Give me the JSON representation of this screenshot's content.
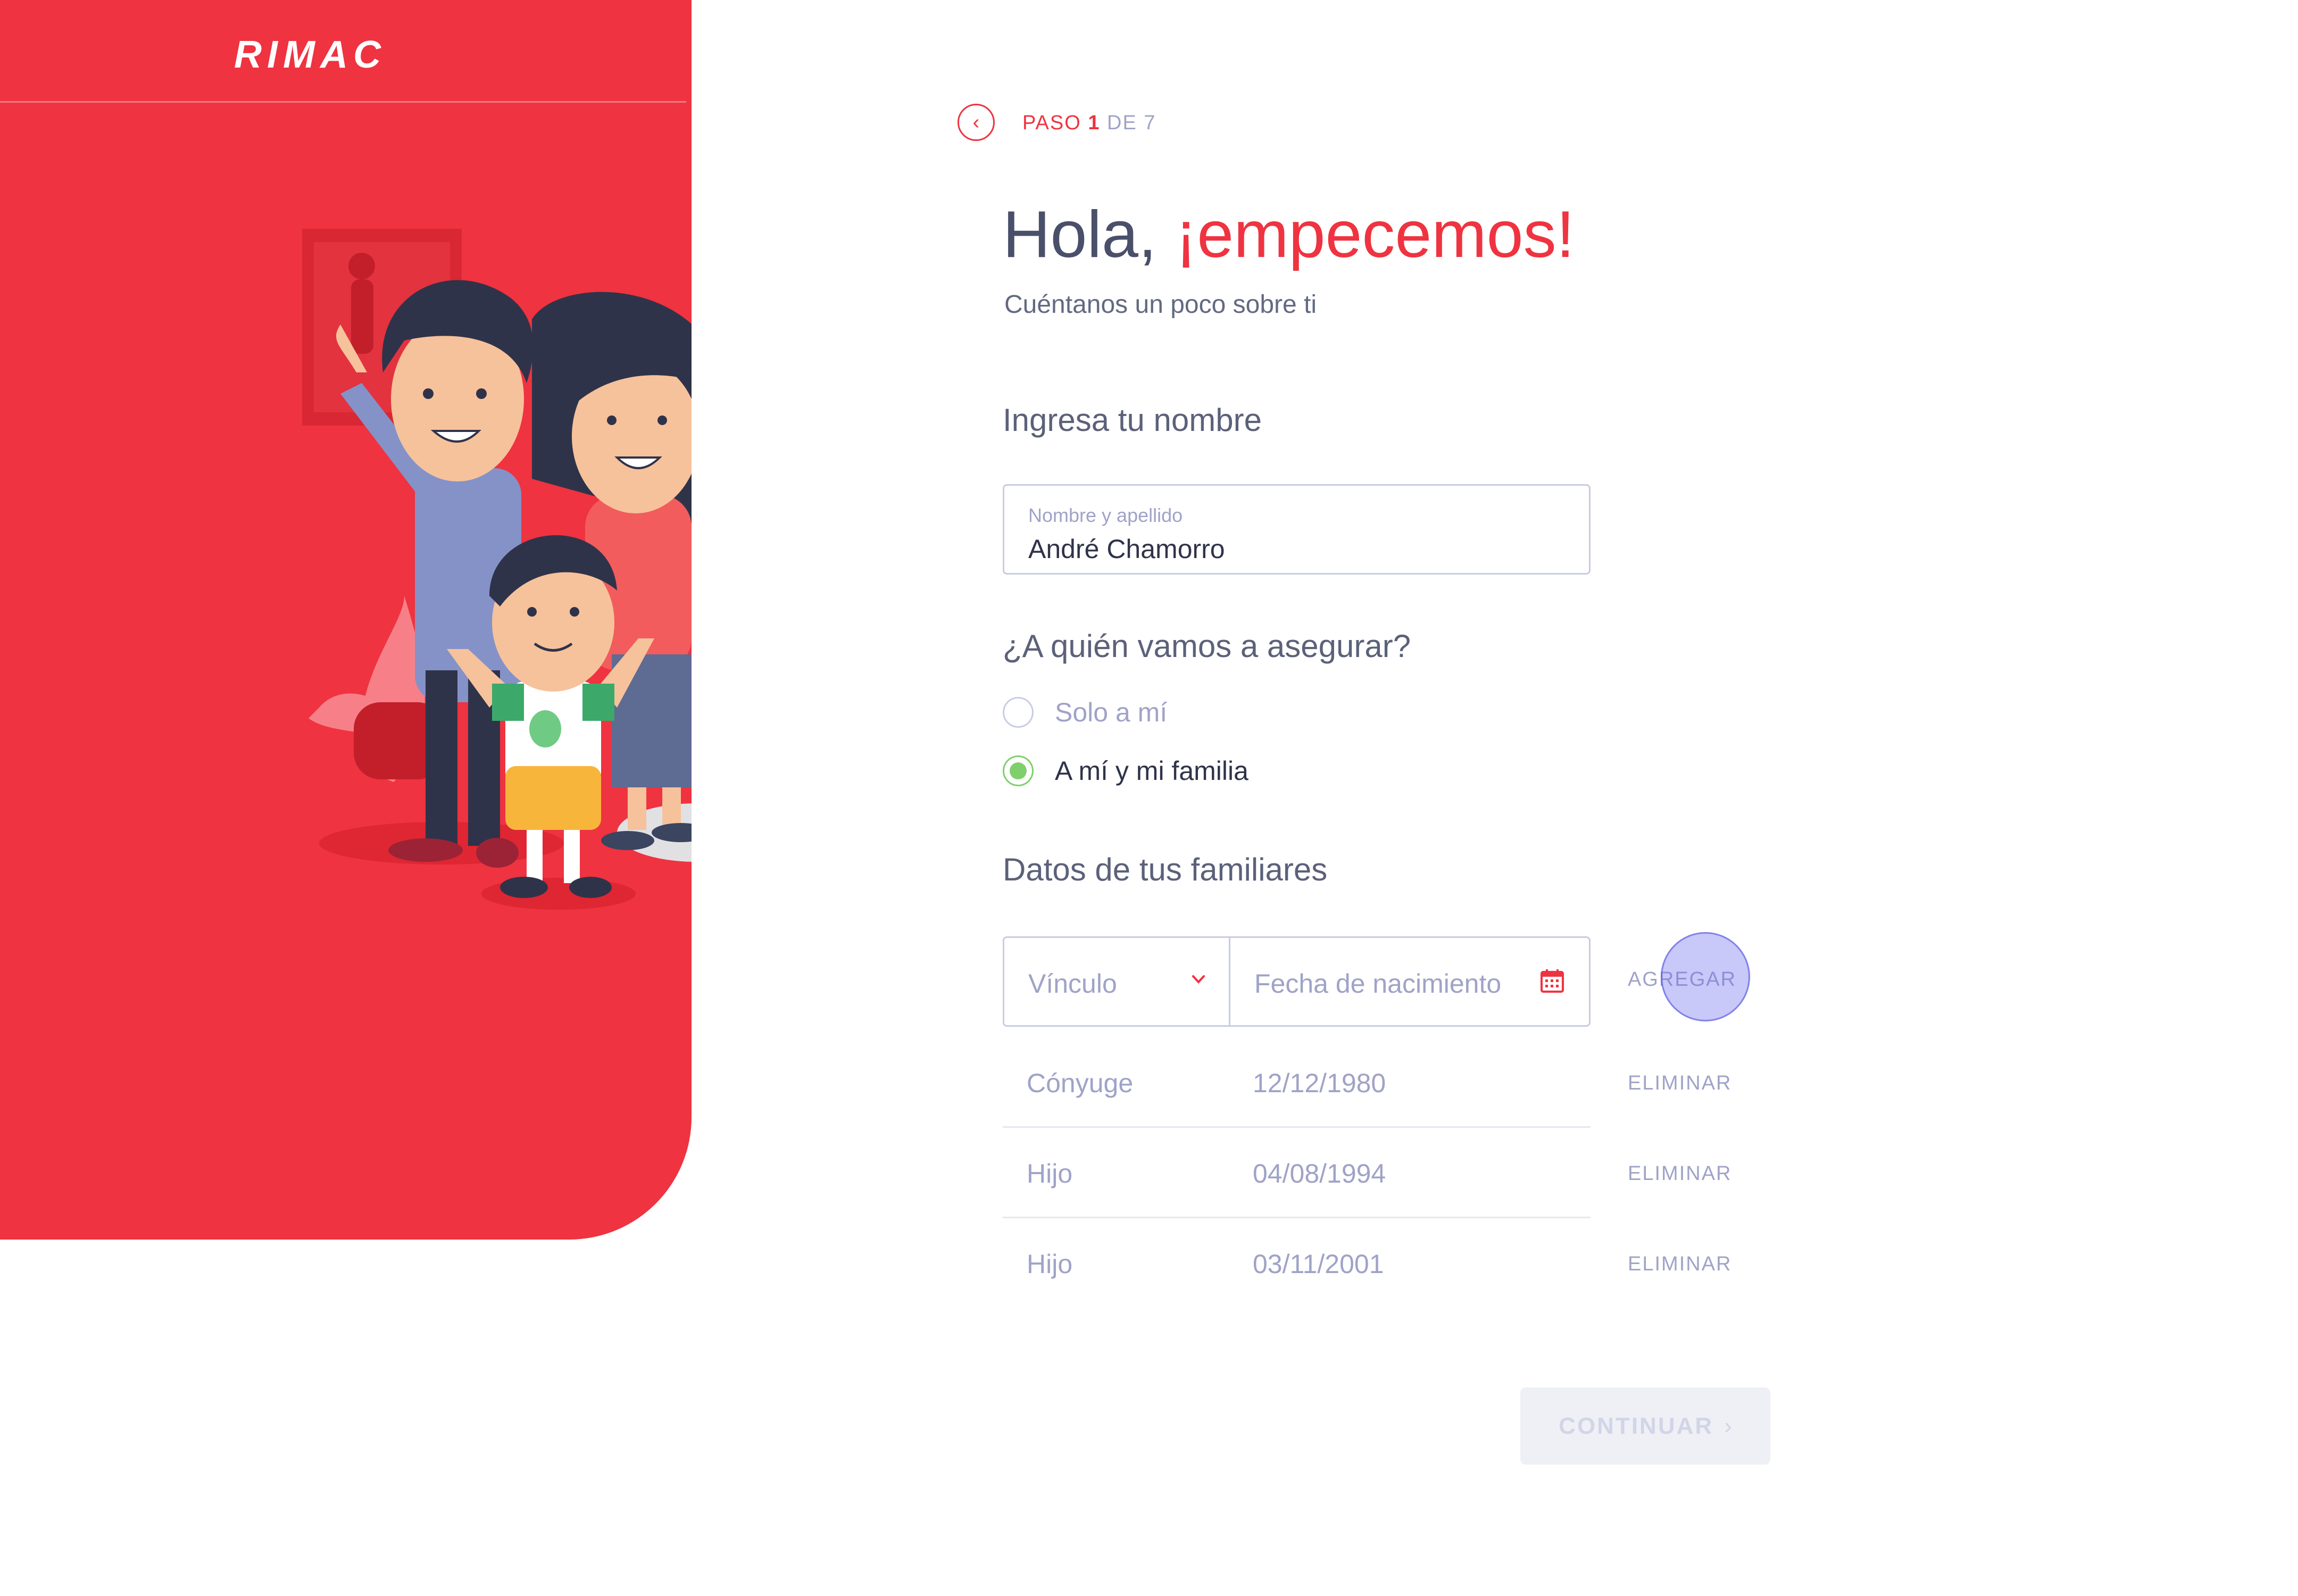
{
  "brand": {
    "logo_text": "RIMAC",
    "primary_color": "#ef3340"
  },
  "stepper": {
    "label": "PASO",
    "current": "1",
    "separator": "DE",
    "total": "7"
  },
  "greeting": {
    "prefix": "Hola, ",
    "highlight": "¡empecemos!",
    "subtitle": "Cuéntanos un poco sobre ti"
  },
  "name_section": {
    "title": "Ingresa tu nombre",
    "field_label": "Nombre y apellido",
    "field_value": "André Chamorro"
  },
  "insure_section": {
    "title": "¿A quién vamos a asegurar?",
    "options": [
      {
        "label": "Solo a mí",
        "selected": false
      },
      {
        "label": "A mí y mi familia",
        "selected": true
      }
    ]
  },
  "family_section": {
    "title": "Datos de tus familiares",
    "relation_placeholder": "Vínculo",
    "birthdate_placeholder": "Fecha de nacimiento",
    "add_label": "AGREGAR",
    "remove_label": "ELIMINAR",
    "members": [
      {
        "relation": "Cónyuge",
        "birthdate": "12/12/1980"
      },
      {
        "relation": "Hijo",
        "birthdate": "04/08/1994"
      },
      {
        "relation": "Hijo",
        "birthdate": "03/11/2001"
      }
    ]
  },
  "footer": {
    "continue_label": "CONTINUAR"
  },
  "icons": [
    "back-arrow-icon",
    "chevron-down-icon",
    "calendar-icon",
    "chevron-right-icon"
  ]
}
